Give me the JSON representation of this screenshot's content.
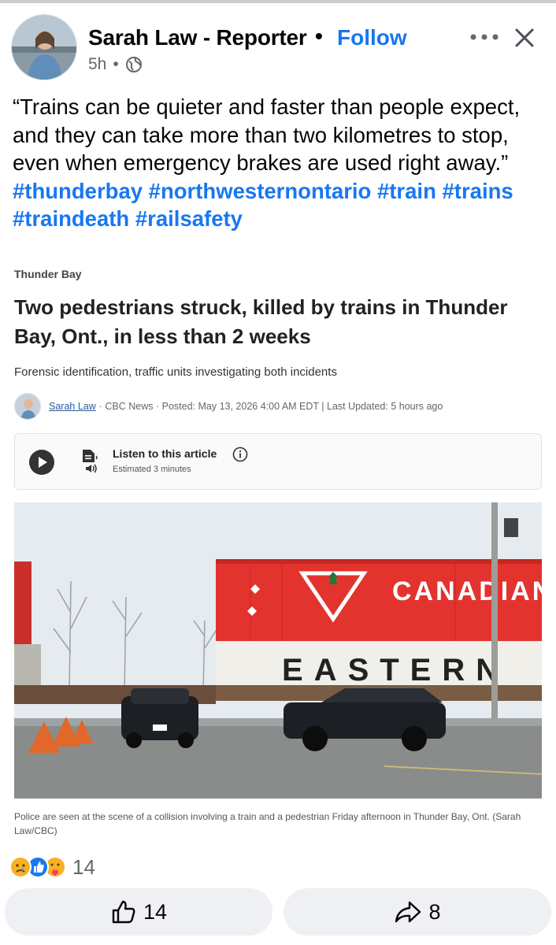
{
  "post": {
    "author": "Sarah Law - Reporter",
    "separator": "•",
    "follow_label": "Follow",
    "time": "5h",
    "time_dot": "•",
    "audience_icon": "globe-icon",
    "text_quote": "“Trains can be quieter and faster than people expect, and they can take more than two kilometres to stop, even when emergency brakes are used right away.”",
    "hashtags": [
      "#thunderbay",
      "#northwesternontario",
      "#train",
      "#trains",
      "#traindeath",
      "#railsafety"
    ]
  },
  "article": {
    "section": "Thunder Bay",
    "title": "Two pedestrians struck, killed by trains in Thunder Bay, Ont., in less than 2 weeks",
    "subtitle": "Forensic identification, traffic units investigating both incidents",
    "byline_author": "Sarah Law",
    "byline_rest": "· CBC News · Posted: May 13, 2026 4:00 AM EDT | Last Updated: 5 hours ago",
    "listen_title": "Listen to this article",
    "listen_estimate": "Estimated 3 minutes",
    "photo_container_text": "CANADIAN T",
    "photo_container_text2": "EASTERN",
    "caption": "Police are seen at the scene of a collision involving a train and a pedestrian Friday afternoon in Thunder Bay, Ont. (Sarah Law/CBC)"
  },
  "reactions": {
    "icons": [
      "sad-reaction-icon",
      "like-reaction-icon",
      "care-reaction-icon"
    ],
    "count": "14"
  },
  "actions": {
    "like_count": "14",
    "share_count": "8"
  },
  "colors": {
    "accent": "#1877f2",
    "secondary_text": "#65676b",
    "button_bg": "#eef0f3",
    "container_red": "#e3332f"
  }
}
